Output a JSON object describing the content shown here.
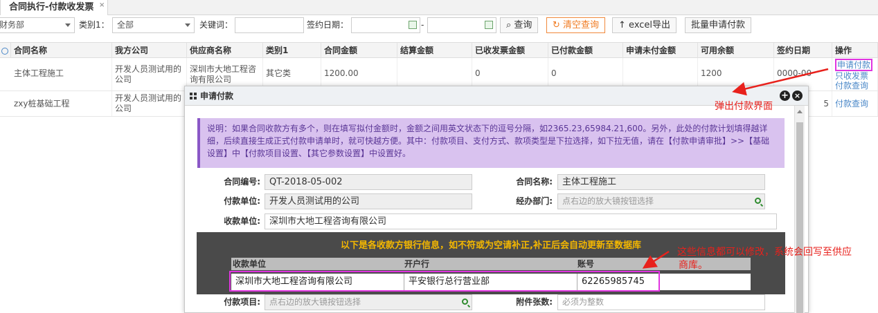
{
  "tab": {
    "title": "合同执行-付款收发票",
    "close": "×"
  },
  "toolbar": {
    "dept_value": "财务部",
    "category_label": "类别1：",
    "category_value": "全部",
    "keyword_label": "关键词：",
    "keyword_value": "",
    "date_label": "签约日期：",
    "date_sep": "-",
    "query_btn": "查询",
    "clear_btn": "清空查询",
    "excel_btn": "excel导出",
    "batch_btn": "批量申请付款",
    "icons": {
      "query": "search-icon",
      "clear": "refresh-icon",
      "excel": "arrow-up-icon"
    }
  },
  "grid": {
    "columns": [
      "合同名称",
      "我方公司",
      "供应商名称",
      "类别1",
      "合同金额",
      "结算金额",
      "已收发票金额",
      "已付款金额",
      "申请未付金额",
      "可用余额",
      "签约日期",
      "操作"
    ],
    "rows": [
      {
        "name": "主体工程施工",
        "company": "开发人员测试用的公司",
        "supplier": "深圳市大地工程咨询有限公司",
        "category": "其它类",
        "amount": "1200.00",
        "settle": "",
        "invoiced": "0",
        "paid": "0",
        "pending": "",
        "balance": "1200",
        "date": "0000-00",
        "ops": [
          "申请付款",
          "只收发票",
          "付款查询"
        ]
      },
      {
        "name": "zxy桩基础工程",
        "company": "开发人员测试用的公司",
        "supplier": "",
        "category": "",
        "amount": "",
        "settle": "",
        "invoiced": "",
        "paid": "",
        "pending": "",
        "balance": "",
        "date": "5",
        "ops": [
          "付款查询"
        ]
      }
    ]
  },
  "dialog": {
    "title": "申请付款",
    "note": "说明：如果合同收款方有多个，则在填写拟付金额时，金额之间用英文状态下的逗号分隔，如2365.23,65984.21,600。另外，此处的付款计划填得越详细，后续直接生成正式付款申请单时，就可快越方便。其中：付款项目、支付方式、款项类型是下拉选择，如下拉无值，请在【付款申请审批】>>【基础设置】中【付款项目设置、【其它参数设置】中设置好。",
    "fields": {
      "contract_no_label": "合同编号:",
      "contract_no": "QT-2018-05-002",
      "contract_name_label": "合同名称:",
      "contract_name": "主体工程施工",
      "pay_unit_label": "付款单位:",
      "pay_unit": "开发人员测试用的公司",
      "dept_label": "经办部门:",
      "dept_placeholder": "点右边的放大镜按钮选择",
      "receiver_label": "收款单位:",
      "receiver": "深圳市大地工程咨询有限公司",
      "pay_item_label": "付款项目:",
      "pay_item_placeholder": "点右边的放大镜按钮选择",
      "attach_label": "附件张数:",
      "attach_placeholder": "必须为整数"
    },
    "bank": {
      "title": "以下是各收款方银行信息，如不符或为空请补正,补正后会自动更新至数据库",
      "headers": [
        "收款单位",
        "开户行",
        "账号"
      ],
      "row": [
        "深圳市大地工程咨询有限公司",
        "平安银行总行营业部",
        "62265985745"
      ]
    }
  },
  "annotations": {
    "popup": "弹出付款界面",
    "editable_line1": "这些信息都可以修改，系统会回写至供应",
    "editable_line2": "商库。"
  },
  "colors": {
    "annotation": "#e8211c",
    "highlight": "#e034e0",
    "note_bg": "#d9c2ef",
    "bank_title": "#f5b800"
  }
}
